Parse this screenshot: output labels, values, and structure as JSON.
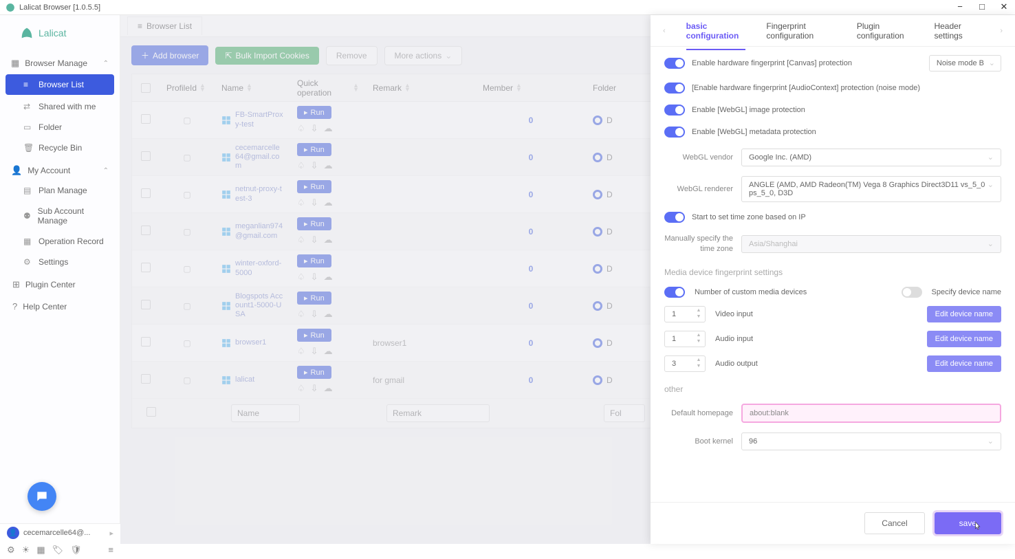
{
  "titlebar": {
    "title": "Lalicat Browser  [1.0.5.5]"
  },
  "logo": "Lalicat",
  "sidebar": {
    "sections": [
      {
        "label": "Browser Manage",
        "items": [
          {
            "label": "Browser List",
            "active": true
          },
          {
            "label": "Shared with me"
          },
          {
            "label": "Folder"
          },
          {
            "label": "Recycle Bin"
          }
        ]
      },
      {
        "label": "My Account",
        "items": [
          {
            "label": "Plan Manage"
          },
          {
            "label": "Sub Account Manage"
          },
          {
            "label": "Operation Record"
          },
          {
            "label": "Settings"
          }
        ]
      }
    ],
    "singles": [
      {
        "label": "Plugin Center"
      },
      {
        "label": "Help Center"
      }
    ]
  },
  "tab": {
    "label": "Browser List"
  },
  "toolbar": {
    "add": "Add browser",
    "import": "Bulk Import Cookies",
    "remove": "Remove",
    "more": "More actions"
  },
  "table": {
    "headers": {
      "profile": "ProfileId",
      "name": "Name",
      "quick": "Quick operation",
      "remark": "Remark",
      "member": "Member",
      "folder": "Folder"
    },
    "run_label": "Run",
    "folder_default": "D",
    "filters": {
      "name": "Name",
      "remark": "Remark",
      "folder": "Fol"
    },
    "rows": [
      {
        "name": "FB-SmartProxy-test",
        "remark": "",
        "member": "0"
      },
      {
        "name": "cecemarcelle64@gmail.com",
        "remark": "",
        "member": "0"
      },
      {
        "name": "netnut-proxy-test-3",
        "remark": "",
        "member": "0"
      },
      {
        "name": "meganlian974@gmail.com",
        "remark": "",
        "member": "0"
      },
      {
        "name": "winter-oxford-5000",
        "remark": "",
        "member": "0"
      },
      {
        "name": "Blogspots Account1-5000-USA",
        "remark": "",
        "member": "0"
      },
      {
        "name": "browser1",
        "remark": "browser1",
        "member": "0"
      },
      {
        "name": "lalicat",
        "remark": "for gmail",
        "member": "0"
      }
    ]
  },
  "panel": {
    "tabs": {
      "basic": "basic configuration",
      "fingerprint": "Fingerprint configuration",
      "plugin": "Plugin configuration",
      "header": "Header settings"
    },
    "rows": {
      "canvas": "Enable hardware fingerprint [Canvas] protection",
      "canvas_mode": "Noise mode B",
      "audio": "[Enable hardware fingerprint [AudioContext] protection (noise mode)",
      "webgl_img": "Enable [WebGL] image protection",
      "webgl_meta": "Enable [WebGL] metadata protection",
      "webgl_vendor_label": "WebGL vendor",
      "webgl_vendor": "Google Inc. (AMD)",
      "webgl_renderer_label": "WebGL renderer",
      "webgl_renderer": "ANGLE (AMD, AMD Radeon(TM) Vega 8 Graphics Direct3D11 vs_5_0 ps_5_0, D3D",
      "tz_ip": "Start to set time zone based on IP",
      "tz_manual_label": "Manually specify the time zone",
      "tz_manual": "Asia/Shanghai"
    },
    "media": {
      "title": "Media device fingerprint settings",
      "custom": "Number of custom media devices",
      "specify": "Specify device name",
      "video": "Video input",
      "audio_in": "Audio input",
      "audio_out": "Audio output",
      "video_val": "1",
      "audio_in_val": "1",
      "audio_out_val": "3",
      "edit": "Edit device name"
    },
    "other": {
      "title": "other",
      "homepage_label": "Default homepage",
      "homepage": "about:blank",
      "kernel_label": "Boot kernel",
      "kernel": "96"
    },
    "footer": {
      "cancel": "Cancel",
      "save": "save"
    }
  },
  "user": "cecemarcelle64@..."
}
